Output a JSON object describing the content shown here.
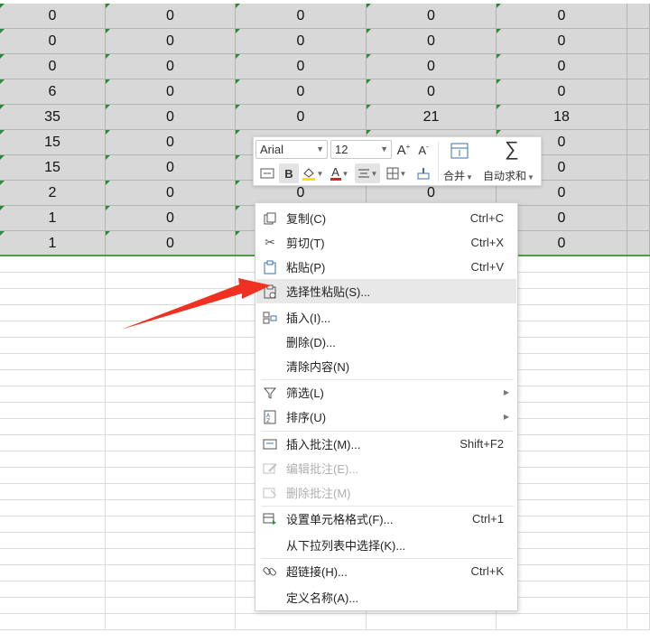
{
  "sheet": {
    "data_rows": [
      [
        "0",
        "0",
        "0",
        "0",
        "0"
      ],
      [
        "0",
        "0",
        "0",
        "0",
        "0"
      ],
      [
        "0",
        "0",
        "0",
        "0",
        "0"
      ],
      [
        "6",
        "0",
        "0",
        "0",
        "0"
      ],
      [
        "35",
        "0",
        "0",
        "21",
        "18"
      ],
      [
        "15",
        "0",
        "",
        "",
        "0"
      ],
      [
        "15",
        "0",
        "",
        "",
        "0"
      ],
      [
        "2",
        "0",
        "0",
        "0",
        "0"
      ],
      [
        "1",
        "0",
        "",
        "",
        "0"
      ],
      [
        "1",
        "0",
        "",
        "",
        "0"
      ]
    ]
  },
  "mini_toolbar": {
    "font_name": "Arial",
    "font_size": "12",
    "increase_font_label": "A",
    "decrease_font_label": "A",
    "bold_label": "B",
    "font_color_label": "A",
    "merge_label": "合并",
    "autosum_label": "自动求和",
    "autosum_symbol": "∑"
  },
  "context_menu": {
    "items": [
      {
        "icon": "copy-icon",
        "label": "复制(C)",
        "shortcut": "Ctrl+C"
      },
      {
        "icon": "scissors-icon",
        "label": "剪切(T)",
        "shortcut": "Ctrl+X"
      },
      {
        "icon": "paste-icon",
        "label": "粘贴(P)",
        "shortcut": "Ctrl+V"
      },
      {
        "icon": "paste-special-icon",
        "label": "选择性粘贴(S)...",
        "shortcut": ""
      },
      {
        "icon": "insert-icon",
        "label": "插入(I)...",
        "shortcut": ""
      },
      {
        "icon": "",
        "label": "删除(D)...",
        "shortcut": ""
      },
      {
        "icon": "",
        "label": "清除内容(N)",
        "shortcut": ""
      },
      {
        "icon": "filter-icon",
        "label": "筛选(L)",
        "shortcut": ""
      },
      {
        "icon": "sort-icon",
        "label": "排序(U)",
        "shortcut": ""
      },
      {
        "icon": "insert-comment-icon",
        "label": "插入批注(M)...",
        "shortcut": "Shift+F2"
      },
      {
        "icon": "edit-comment-icon",
        "label": "编辑批注(E)...",
        "shortcut": ""
      },
      {
        "icon": "delete-comment-icon",
        "label": "删除批注(M)",
        "shortcut": ""
      },
      {
        "icon": "format-cells-icon",
        "label": "设置单元格格式(F)...",
        "shortcut": "Ctrl+1"
      },
      {
        "icon": "",
        "label": "从下拉列表中选择(K)...",
        "shortcut": ""
      },
      {
        "icon": "link-icon",
        "label": "超链接(H)...",
        "shortcut": "Ctrl+K"
      },
      {
        "icon": "",
        "label": "定义名称(A)...",
        "shortcut": ""
      }
    ]
  },
  "colors": {
    "selected_cell_bg": "#d8d8d8",
    "annotation_arrow": "#f03020",
    "selection_border": "#4aa040",
    "menu_hover_bg": "#e8e8e8"
  }
}
